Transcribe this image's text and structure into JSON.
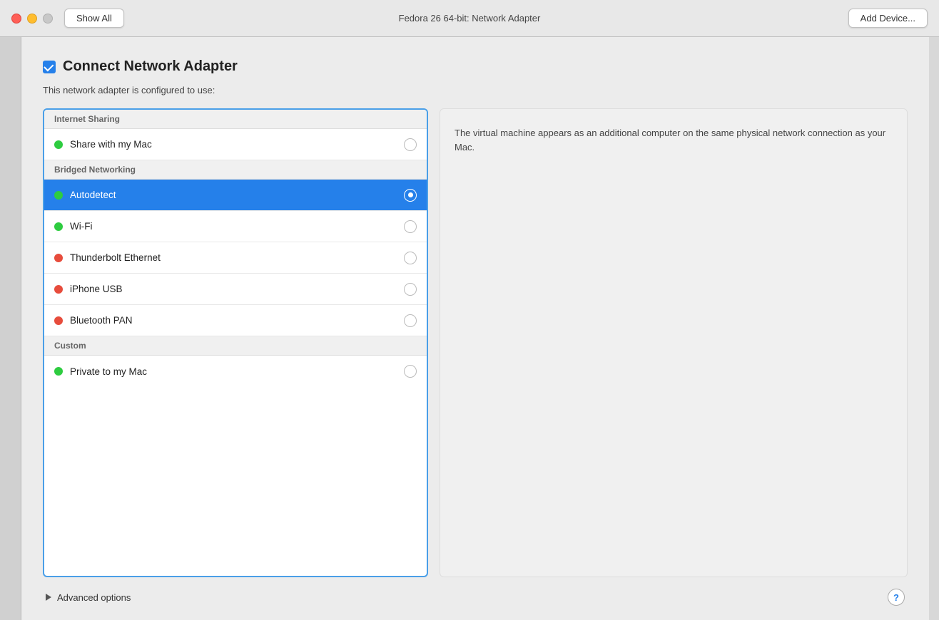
{
  "titlebar": {
    "show_all_label": "Show All",
    "title": "Fedora 26 64-bit: Network Adapter",
    "add_device_label": "Add Device..."
  },
  "header": {
    "connect_label": "Connect Network Adapter",
    "subtitle": "This network adapter is configured to use:"
  },
  "network_list": {
    "groups": [
      {
        "id": "internet-sharing",
        "label": "Internet Sharing",
        "items": [
          {
            "id": "share-my-mac",
            "label": "Share with my Mac",
            "dot": "green",
            "selected": false
          }
        ]
      },
      {
        "id": "bridged-networking",
        "label": "Bridged Networking",
        "items": [
          {
            "id": "autodetect",
            "label": "Autodetect",
            "dot": "green",
            "selected": true
          },
          {
            "id": "wi-fi",
            "label": "Wi-Fi",
            "dot": "green",
            "selected": false
          },
          {
            "id": "thunderbolt-ethernet",
            "label": "Thunderbolt Ethernet",
            "dot": "red",
            "selected": false
          },
          {
            "id": "iphone-usb",
            "label": "iPhone USB",
            "dot": "red",
            "selected": false
          },
          {
            "id": "bluetooth-pan",
            "label": "Bluetooth PAN",
            "dot": "red",
            "selected": false
          }
        ]
      },
      {
        "id": "custom",
        "label": "Custom",
        "items": [
          {
            "id": "private-to-my-mac",
            "label": "Private to my Mac",
            "dot": "green",
            "selected": false
          }
        ]
      }
    ]
  },
  "info_panel": {
    "text": "The virtual machine appears as an additional computer on the same physical network connection as your Mac."
  },
  "bottom": {
    "advanced_label": "Advanced options",
    "help_label": "?"
  }
}
